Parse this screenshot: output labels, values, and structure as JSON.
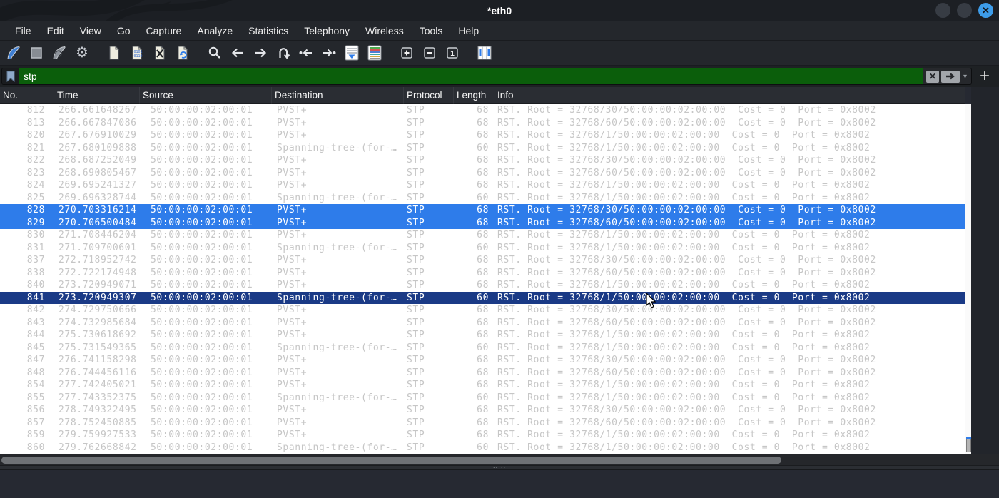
{
  "window": {
    "title": "*eth0"
  },
  "window_controls": {
    "minimize": "minimize-circle",
    "maximize": "maximize-circle",
    "close": "close-circle-x",
    "close_color": "#3d9ce9"
  },
  "menu": {
    "items": [
      "File",
      "Edit",
      "View",
      "Go",
      "Capture",
      "Analyze",
      "Statistics",
      "Telephony",
      "Wireless",
      "Tools",
      "Help"
    ]
  },
  "toolbar": {
    "icons": [
      "capture-start-fin-icon",
      "capture-stop-icon",
      "capture-restart-fin-icon",
      "capture-options-gear-icon",
      "file-open-icon",
      "file-save-icon",
      "file-close-icon",
      "file-reload-icon",
      "find-packet-icon",
      "go-back-icon",
      "go-forward-icon",
      "go-to-packet-icon",
      "go-first-packet-icon",
      "go-last-packet-icon",
      "auto-scroll-icon",
      "colorize-icon",
      "zoom-in-icon",
      "zoom-out-icon",
      "zoom-normal-icon",
      "resize-columns-icon"
    ]
  },
  "filter": {
    "value": "stp",
    "bookmark_icon": "bookmark-icon",
    "clear_label": "✕",
    "apply_icon": "apply-arrow-icon",
    "dropdown_caret": "▾",
    "add_button_label": "+",
    "valid_bg_color": "#0b5e0b"
  },
  "colors": {
    "selected_row_bg": "#2e7cea",
    "current_row_bg": "#1a3a86",
    "normal_row_text": "#c6c6c6",
    "list_bg": "#ffffff",
    "chrome_bg": "#24272c"
  },
  "table": {
    "columns": [
      "No.",
      "Time",
      "Source",
      "Destination",
      "Protocol",
      "Length",
      "Info"
    ],
    "rows": [
      {
        "no": "812",
        "time": "266.661648267",
        "source": "50:00:00:02:00:01",
        "destination": "PVST+",
        "protocol": "STP",
        "length": "68",
        "info": "RST. Root = 32768/30/50:00:00:02:00:00  Cost = 0  Port = 0x8002",
        "state": "normal"
      },
      {
        "no": "813",
        "time": "266.667847086",
        "source": "50:00:00:02:00:01",
        "destination": "PVST+",
        "protocol": "STP",
        "length": "68",
        "info": "RST. Root = 32768/60/50:00:00:02:00:00  Cost = 0  Port = 0x8002",
        "state": "normal"
      },
      {
        "no": "820",
        "time": "267.676910029",
        "source": "50:00:00:02:00:01",
        "destination": "PVST+",
        "protocol": "STP",
        "length": "68",
        "info": "RST. Root = 32768/1/50:00:00:02:00:00  Cost = 0  Port = 0x8002",
        "state": "normal"
      },
      {
        "no": "821",
        "time": "267.680109888",
        "source": "50:00:00:02:00:01",
        "destination": "Spanning-tree-(for-…",
        "protocol": "STP",
        "length": "60",
        "info": "RST. Root = 32768/1/50:00:00:02:00:00  Cost = 0  Port = 0x8002",
        "state": "normal"
      },
      {
        "no": "822",
        "time": "268.687252049",
        "source": "50:00:00:02:00:01",
        "destination": "PVST+",
        "protocol": "STP",
        "length": "68",
        "info": "RST. Root = 32768/30/50:00:00:02:00:00  Cost = 0  Port = 0x8002",
        "state": "normal"
      },
      {
        "no": "823",
        "time": "268.690805467",
        "source": "50:00:00:02:00:01",
        "destination": "PVST+",
        "protocol": "STP",
        "length": "68",
        "info": "RST. Root = 32768/60/50:00:00:02:00:00  Cost = 0  Port = 0x8002",
        "state": "normal"
      },
      {
        "no": "824",
        "time": "269.695241327",
        "source": "50:00:00:02:00:01",
        "destination": "PVST+",
        "protocol": "STP",
        "length": "68",
        "info": "RST. Root = 32768/1/50:00:00:02:00:00  Cost = 0  Port = 0x8002",
        "state": "normal"
      },
      {
        "no": "825",
        "time": "269.696328744",
        "source": "50:00:00:02:00:01",
        "destination": "Spanning-tree-(for-…",
        "protocol": "STP",
        "length": "60",
        "info": "RST. Root = 32768/1/50:00:00:02:00:00  Cost = 0  Port = 0x8002",
        "state": "normal"
      },
      {
        "no": "828",
        "time": "270.703316214",
        "source": "50:00:00:02:00:01",
        "destination": "PVST+",
        "protocol": "STP",
        "length": "68",
        "info": "RST. Root = 32768/30/50:00:00:02:00:00  Cost = 0  Port = 0x8002",
        "state": "selected"
      },
      {
        "no": "829",
        "time": "270.706500484",
        "source": "50:00:00:02:00:01",
        "destination": "PVST+",
        "protocol": "STP",
        "length": "68",
        "info": "RST. Root = 32768/60/50:00:00:02:00:00  Cost = 0  Port = 0x8002",
        "state": "selected"
      },
      {
        "no": "830",
        "time": "271.708446204",
        "source": "50:00:00:02:00:01",
        "destination": "PVST+",
        "protocol": "STP",
        "length": "68",
        "info": "RST. Root = 32768/1/50:00:00:02:00:00  Cost = 0  Port = 0x8002",
        "state": "normal"
      },
      {
        "no": "831",
        "time": "271.709700601",
        "source": "50:00:00:02:00:01",
        "destination": "Spanning-tree-(for-…",
        "protocol": "STP",
        "length": "60",
        "info": "RST. Root = 32768/1/50:00:00:02:00:00  Cost = 0  Port = 0x8002",
        "state": "normal"
      },
      {
        "no": "837",
        "time": "272.718952742",
        "source": "50:00:00:02:00:01",
        "destination": "PVST+",
        "protocol": "STP",
        "length": "68",
        "info": "RST. Root = 32768/30/50:00:00:02:00:00  Cost = 0  Port = 0x8002",
        "state": "normal"
      },
      {
        "no": "838",
        "time": "272.722174948",
        "source": "50:00:00:02:00:01",
        "destination": "PVST+",
        "protocol": "STP",
        "length": "68",
        "info": "RST. Root = 32768/60/50:00:00:02:00:00  Cost = 0  Port = 0x8002",
        "state": "normal"
      },
      {
        "no": "840",
        "time": "273.720949071",
        "source": "50:00:00:02:00:01",
        "destination": "PVST+",
        "protocol": "STP",
        "length": "68",
        "info": "RST. Root = 32768/1/50:00:00:02:00:00  Cost = 0  Port = 0x8002",
        "state": "normal"
      },
      {
        "no": "841",
        "time": "273.720949307",
        "source": "50:00:00:02:00:01",
        "destination": "Spanning-tree-(for-…",
        "protocol": "STP",
        "length": "60",
        "info": "RST. Root = 32768/1/50:00:00:02:00:00  Cost = 0  Port = 0x8002",
        "state": "current"
      },
      {
        "no": "842",
        "time": "274.729750666",
        "source": "50:00:00:02:00:01",
        "destination": "PVST+",
        "protocol": "STP",
        "length": "68",
        "info": "RST. Root = 32768/30/50:00:00:02:00:00  Cost = 0  Port = 0x8002",
        "state": "normal"
      },
      {
        "no": "843",
        "time": "274.732985684",
        "source": "50:00:00:02:00:01",
        "destination": "PVST+",
        "protocol": "STP",
        "length": "68",
        "info": "RST. Root = 32768/60/50:00:00:02:00:00  Cost = 0  Port = 0x8002",
        "state": "normal"
      },
      {
        "no": "844",
        "time": "275.730618692",
        "source": "50:00:00:02:00:01",
        "destination": "PVST+",
        "protocol": "STP",
        "length": "68",
        "info": "RST. Root = 32768/1/50:00:00:02:00:00  Cost = 0  Port = 0x8002",
        "state": "normal"
      },
      {
        "no": "845",
        "time": "275.731549365",
        "source": "50:00:00:02:00:01",
        "destination": "Spanning-tree-(for-…",
        "protocol": "STP",
        "length": "60",
        "info": "RST. Root = 32768/1/50:00:00:02:00:00  Cost = 0  Port = 0x8002",
        "state": "normal"
      },
      {
        "no": "847",
        "time": "276.741158298",
        "source": "50:00:00:02:00:01",
        "destination": "PVST+",
        "protocol": "STP",
        "length": "68",
        "info": "RST. Root = 32768/30/50:00:00:02:00:00  Cost = 0  Port = 0x8002",
        "state": "normal"
      },
      {
        "no": "848",
        "time": "276.744456116",
        "source": "50:00:00:02:00:01",
        "destination": "PVST+",
        "protocol": "STP",
        "length": "68",
        "info": "RST. Root = 32768/60/50:00:00:02:00:00  Cost = 0  Port = 0x8002",
        "state": "normal"
      },
      {
        "no": "854",
        "time": "277.742405021",
        "source": "50:00:00:02:00:01",
        "destination": "PVST+",
        "protocol": "STP",
        "length": "68",
        "info": "RST. Root = 32768/1/50:00:00:02:00:00  Cost = 0  Port = 0x8002",
        "state": "normal"
      },
      {
        "no": "855",
        "time": "277.743352375",
        "source": "50:00:00:02:00:01",
        "destination": "Spanning-tree-(for-…",
        "protocol": "STP",
        "length": "60",
        "info": "RST. Root = 32768/1/50:00:00:02:00:00  Cost = 0  Port = 0x8002",
        "state": "normal"
      },
      {
        "no": "856",
        "time": "278.749322495",
        "source": "50:00:00:02:00:01",
        "destination": "PVST+",
        "protocol": "STP",
        "length": "68",
        "info": "RST. Root = 32768/30/50:00:00:02:00:00  Cost = 0  Port = 0x8002",
        "state": "normal"
      },
      {
        "no": "857",
        "time": "278.752450885",
        "source": "50:00:00:02:00:01",
        "destination": "PVST+",
        "protocol": "STP",
        "length": "68",
        "info": "RST. Root = 32768/60/50:00:00:02:00:00  Cost = 0  Port = 0x8002",
        "state": "normal"
      },
      {
        "no": "859",
        "time": "279.759927533",
        "source": "50:00:00:02:00:01",
        "destination": "PVST+",
        "protocol": "STP",
        "length": "68",
        "info": "RST. Root = 32768/1/50:00:00:02:00:00  Cost = 0  Port = 0x8002",
        "state": "normal"
      },
      {
        "no": "860",
        "time": "279.762668842",
        "source": "50:00:00:02:00:01",
        "destination": "Spanning-tree-(for-…",
        "protocol": "STP",
        "length": "60",
        "info": "RST. Root = 32768/1/50:00:00:02:00:00  Cost = 0  Port = 0x8002",
        "state": "normal"
      }
    ]
  },
  "splitter": {
    "dots": "·····"
  }
}
